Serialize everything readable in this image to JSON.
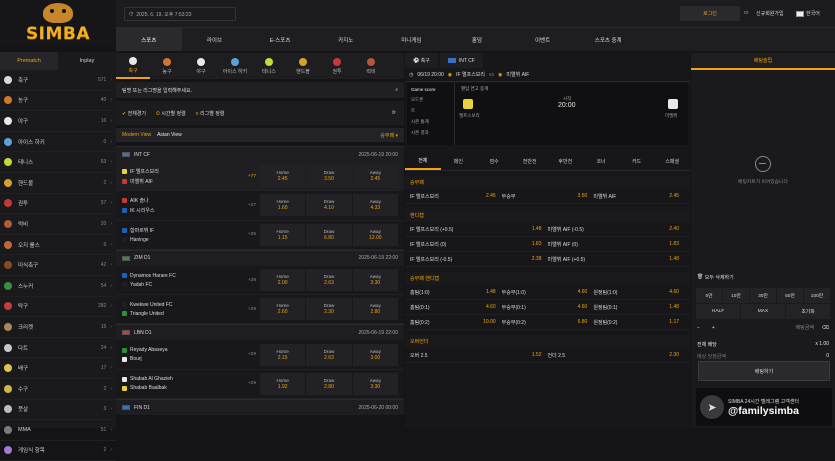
{
  "brand": {
    "name": "SIMBA"
  },
  "header": {
    "datetime": "2025. 6. 19. 오후 7:53:23",
    "login": "로그인",
    "or": "or",
    "signup": "신규회원가입",
    "language": "한국어"
  },
  "main_nav": [
    "스포츠",
    "라이브",
    "E-스포츠",
    "카지노",
    "미니게임",
    "홀덤",
    "이벤트",
    "스포츠 중계"
  ],
  "sidebar": {
    "tabs": [
      "Prematch",
      "Inplay"
    ],
    "sports": [
      {
        "name": "축구",
        "count": "571",
        "color": "#d8d8d8"
      },
      {
        "name": "농구",
        "count": "40",
        "color": "#d2762b"
      },
      {
        "name": "야구",
        "count": "16",
        "color": "#e8e8e8"
      },
      {
        "name": "아이스 하키",
        "count": "0",
        "color": "#5aa3d8"
      },
      {
        "name": "테니스",
        "count": "63",
        "color": "#c7d83a"
      },
      {
        "name": "핸드볼",
        "count": "2",
        "color": "#d6a12a"
      },
      {
        "name": "권투",
        "count": "57",
        "color": "#c73838"
      },
      {
        "name": "럭비",
        "count": "20",
        "color": "#b05a3a"
      },
      {
        "name": "오지 룰스",
        "count": "6",
        "color": "#c06a34"
      },
      {
        "name": "미식축구",
        "count": "42",
        "color": "#8a4a26"
      },
      {
        "name": "스누커",
        "count": "54",
        "color": "#3d8c3d"
      },
      {
        "name": "탁구",
        "count": "282",
        "color": "#c43c3c"
      },
      {
        "name": "크리켓",
        "count": "15",
        "color": "#a68a55"
      },
      {
        "name": "다트",
        "count": "24",
        "color": "#c8c8c8"
      },
      {
        "name": "배구",
        "count": "17",
        "color": "#e0c24a"
      },
      {
        "name": "수구",
        "count": "2",
        "color": "#d2b64a"
      },
      {
        "name": "풋살",
        "count": "3",
        "color": "#bdbdbd"
      },
      {
        "name": "MMA",
        "count": "51",
        "color": "#7a7a7a"
      },
      {
        "name": "게임식 항목",
        "count": "2",
        "color": "#a37ad1"
      }
    ]
  },
  "sport_tabs": [
    {
      "label": "축구",
      "color": "#e8e8e8"
    },
    {
      "label": "농구",
      "color": "#d2762b"
    },
    {
      "label": "야구",
      "color": "#e8e8e8"
    },
    {
      "label": "아이스 하키",
      "color": "#5aa3d8"
    },
    {
      "label": "테니스",
      "color": "#c7d83a"
    },
    {
      "label": "핸드볼",
      "color": "#d6a12a"
    },
    {
      "label": "권투",
      "color": "#c73838"
    },
    {
      "label": "럭비",
      "color": "#b05a3a"
    }
  ],
  "search": {
    "placeholder": "팀명 또는 리그명을 입력해주세요."
  },
  "filters": [
    "전체경기",
    "시간별 정렬",
    "리그별 정렬"
  ],
  "view": {
    "modern": "Modern View",
    "asian": "Asian View",
    "sort": "승무패"
  },
  "leagues": [
    {
      "name": "INT CF",
      "date": "2025-06-19 20:00",
      "flag": "#3a6fc4",
      "matches": [
        {
          "home": "IF 엘프스보리",
          "away": "미엘뷔 AIF",
          "more": "+77",
          "h": "2.45",
          "d": "3.50",
          "a": "2.45",
          "sel": true
        },
        {
          "home": "AIK 솔나",
          "away": "IK 시리우스",
          "more": "+27",
          "h": "1.60",
          "d": "4.10",
          "a": "4.33"
        },
        {
          "home": "함마르뷔 IF",
          "away": "Haninge",
          "more": "+25",
          "h": "1.15",
          "d": "6.80",
          "a": "12.00"
        }
      ]
    },
    {
      "name": "ZIM D1",
      "date": "2025-06-19 22:00",
      "flag": "#2f8f3a",
      "matches": [
        {
          "home": "Dynamos Harare FC",
          "away": "Yadah FC",
          "more": "+29",
          "h": "2.00",
          "d": "2.63",
          "a": "3.30"
        },
        {
          "home": "Kwekwe United FC",
          "away": "Triangle United",
          "more": "+29",
          "h": "2.60",
          "d": "2.30",
          "a": "2.80"
        }
      ]
    },
    {
      "name": "LBN D1",
      "date": "2025-06-19 22:00",
      "flag": "#d23a3a",
      "matches": [
        {
          "home": "Reyady Abaseya",
          "away": "Bourj",
          "more": "+29",
          "h": "2.15",
          "d": "2.63",
          "a": "3.00"
        },
        {
          "home": "Shabab Al Ghazieh",
          "away": "Shabab Baalbak",
          "more": "+29",
          "h": "1.92",
          "d": "2.80",
          "a": "3.30"
        }
      ]
    },
    {
      "name": "FIN D1",
      "date": "2025-06-20 00:00",
      "flag": "#3a6fc4",
      "matches": []
    }
  ],
  "odds_labels": {
    "home": "Home",
    "draw": "Draw",
    "away": "Away"
  },
  "detail": {
    "tab_sport": "축구",
    "tab_league": "INT CF",
    "datetime": "06/19 20:00",
    "home": "IF 엘프스보리",
    "vs": "vs",
    "away": "미엘뷔 AIF",
    "score_left": [
      "Game score",
      "모드론",
      "트",
      "시즌 통계",
      "시즌 결과"
    ],
    "board_title": "팬텀 연고 중계",
    "time_label": "시작",
    "time": "20:00",
    "home_short": "엘프스보리",
    "away_short": "미엘뷔",
    "bet_tabs": [
      "전체",
      "메인",
      "점수",
      "전반전",
      "후반전",
      "코너",
      "카드",
      "스페셜"
    ],
    "sections": [
      {
        "title": "승무패",
        "rows": [
          [
            [
              "IF 엘프스보리",
              "2.45"
            ],
            [
              "무승부",
              "3.50"
            ],
            [
              "미엘뷔 AIF",
              "2.45"
            ]
          ]
        ]
      },
      {
        "title": "핸디캡",
        "rows": [
          [
            [
              "IF 엘프스보리 (+0.5)",
              "1.48"
            ],
            [
              "미엘뷔 AIF (-0.5)",
              "2.40"
            ]
          ],
          [
            [
              "IF 엘프스보리 (0)",
              "1.83"
            ],
            [
              "미엘뷔 AIF (0)",
              "1.83"
            ]
          ],
          [
            [
              "IF 엘프스보리 (-0.5)",
              "2.38"
            ],
            [
              "미엘뷔 AIF (+0.5)",
              "1.48"
            ]
          ]
        ]
      },
      {
        "title": "승무패 핸디캡",
        "rows": [
          [
            [
              "홈팀(1:0)",
              "1.48"
            ],
            [
              "무승부(1:0)",
              "4.60"
            ],
            [
              "원정팀(1:0)",
              "4.60"
            ]
          ],
          [
            [
              "홈팀(0:1)",
              "4.60"
            ],
            [
              "무승부(0:1)",
              "4.60"
            ],
            [
              "원정팀(0:1)",
              "1.48"
            ]
          ],
          [
            [
              "홈팀(0:2)",
              "10.00"
            ],
            [
              "무승부(0:2)",
              "6.80"
            ],
            [
              "원정팀(0:2)",
              "1.17"
            ]
          ]
        ]
      },
      {
        "title": "오버언더",
        "rows": [
          [
            [
              "오버 2.5",
              "1.52"
            ],
            [
              "언더 2.5",
              "2.30"
            ]
          ]
        ]
      }
    ]
  },
  "betslip": {
    "title": "배팅슬립",
    "empty": "배팅카트가 비어있습니다",
    "clear": "모두 삭제하기",
    "quick": [
      "5만",
      "10만",
      "30만",
      "50만",
      "100만"
    ],
    "half": "HALF",
    "max": "MAX",
    "reset": "초기화",
    "amount_label": "배팅금액",
    "total_odds_label": "전체 배당",
    "total_odds": "x 1.00",
    "expected_label": "예상 당첨금액",
    "expected": "0",
    "place": "배팅하기",
    "tg_line": "SIMBA 24시간 텔레그램 고객센터",
    "tg_handle": "@familysimba"
  }
}
